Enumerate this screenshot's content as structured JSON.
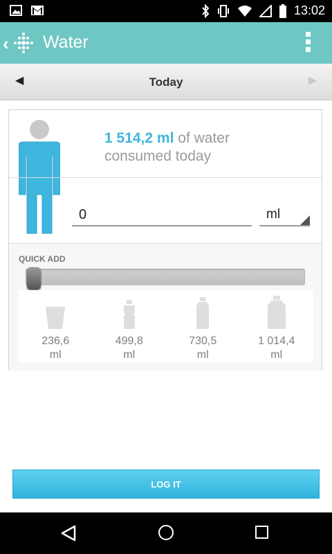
{
  "status": {
    "time": "13:02"
  },
  "appbar": {
    "title": "Water"
  },
  "date_nav": {
    "label": "Today"
  },
  "summary": {
    "amount": "1 514,2 ml",
    "suffix_line1": " of water",
    "line2": "consumed today"
  },
  "entry": {
    "value": "0",
    "unit": "ml"
  },
  "quick_add": {
    "label": "QUICK ADD",
    "slider_fraction": 0.0,
    "items": [
      {
        "icon": "cup-icon",
        "value": "236,6",
        "unit": "ml"
      },
      {
        "icon": "small-bottle-icon",
        "value": "499,8",
        "unit": "ml"
      },
      {
        "icon": "medium-bottle-icon",
        "value": "730,5",
        "unit": "ml"
      },
      {
        "icon": "large-bottle-icon",
        "value": "1 014,4",
        "unit": "ml"
      }
    ]
  },
  "log_button": {
    "label": "LOG IT"
  },
  "colors": {
    "appbar": "#6ec7c3",
    "accent": "#3fb6de",
    "person": "#3fb6de"
  }
}
